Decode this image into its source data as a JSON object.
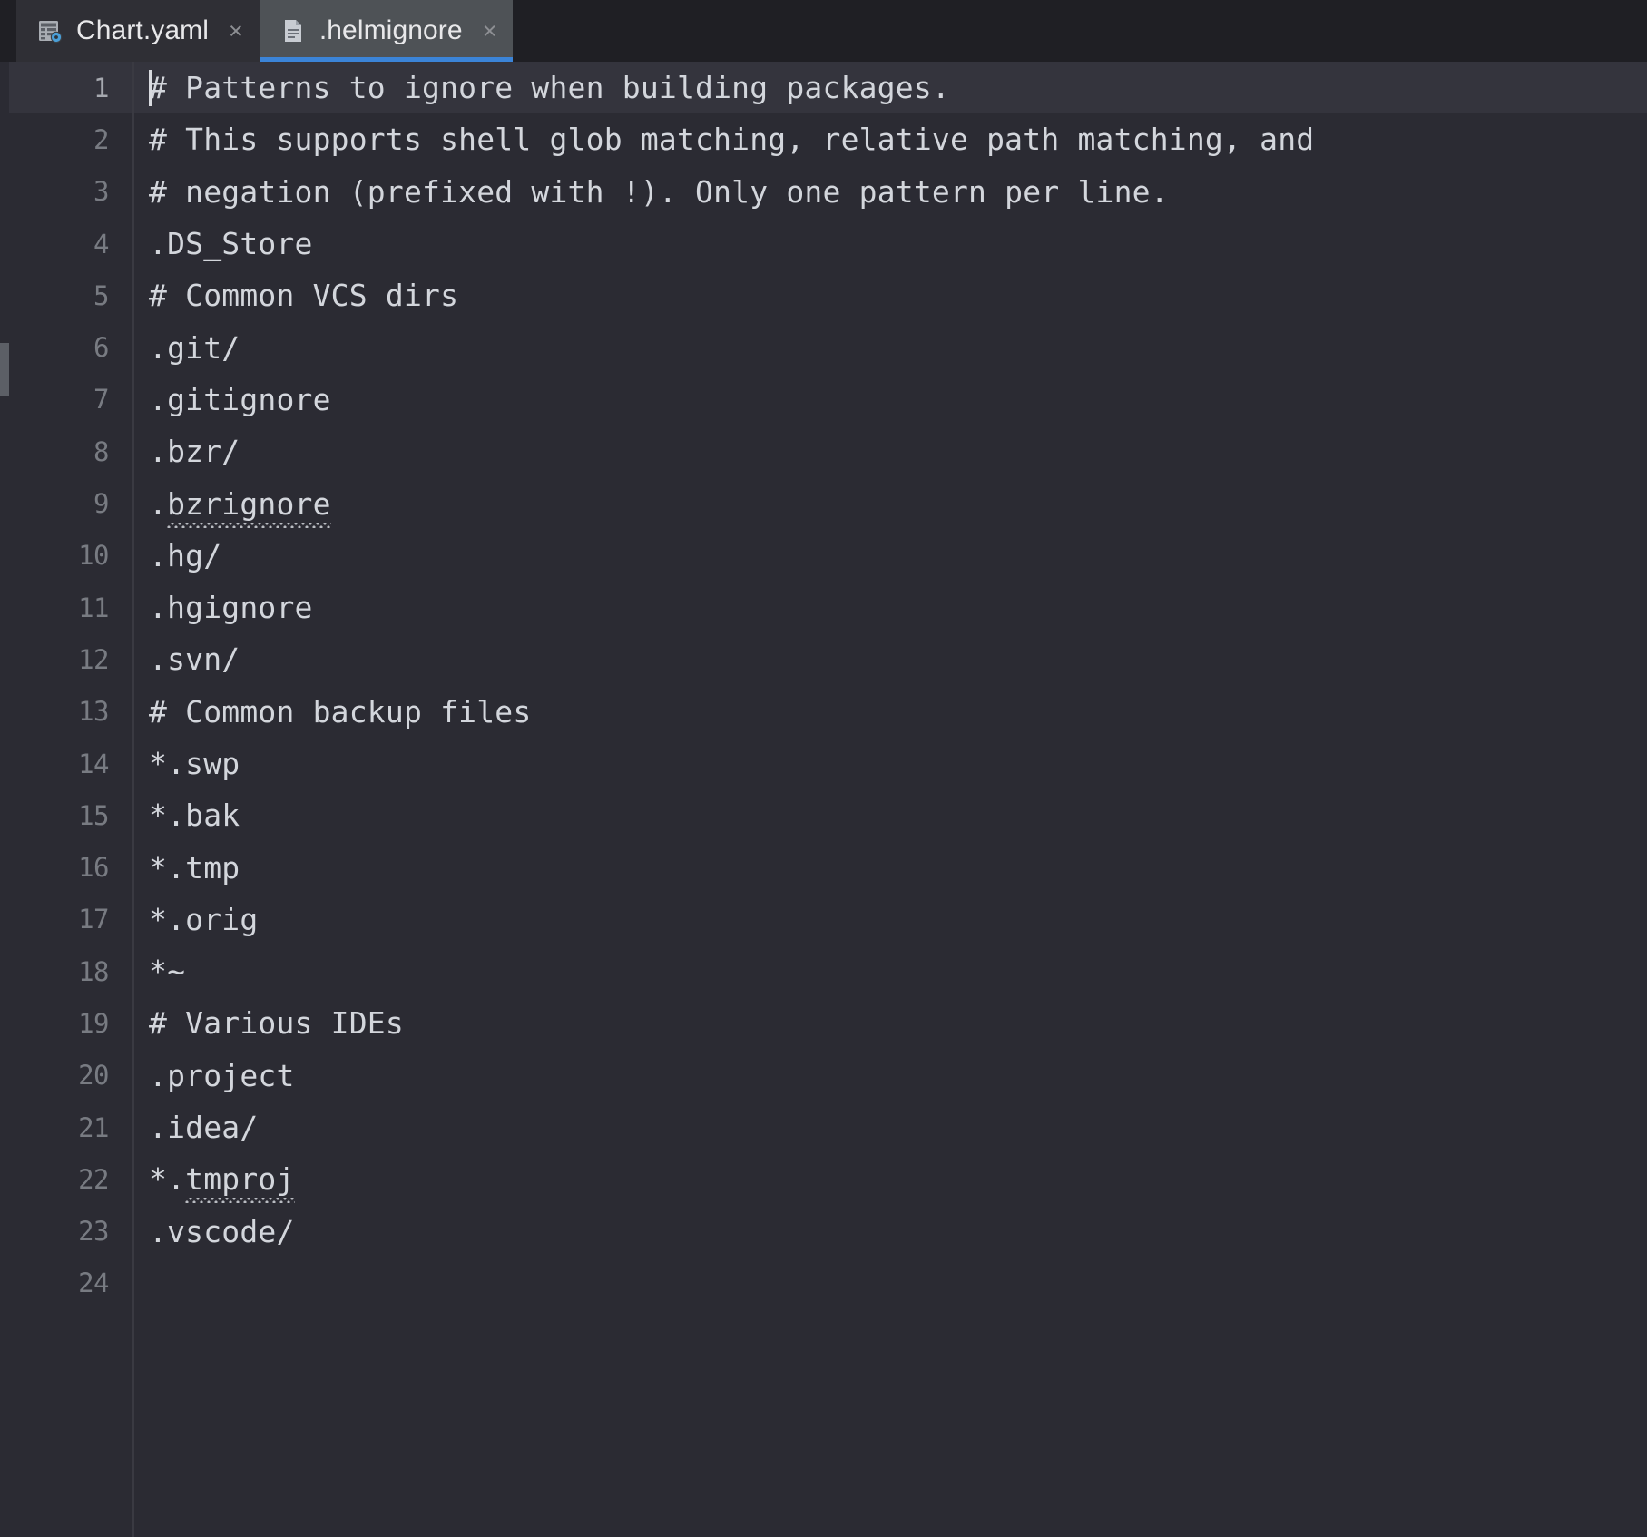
{
  "window": {
    "theme": "darcula",
    "colors": {
      "editor_bg": "#2b2b33",
      "tabbar_bg": "#1f1f24",
      "tab_active_bg": "#4e5256",
      "tab_inactive_bg": "#2f2f35",
      "active_tab_underline": "#3b84d8",
      "gutter_text": "#787b82",
      "code_text": "#d3d6dc",
      "current_line_bg": "#34343d",
      "squiggle": "#b9bcc2"
    }
  },
  "tabs": [
    {
      "label": "Chart.yaml",
      "icon": "yaml-config-file-icon",
      "close_glyph": "×",
      "active": false
    },
    {
      "label": ".helmignore",
      "icon": "text-file-icon",
      "close_glyph": "×",
      "active": true
    }
  ],
  "editor": {
    "active_file": ".helmignore",
    "caret": {
      "line": 1,
      "column": 1
    },
    "current_line": 1,
    "total_lines": 24,
    "line_numbers": [
      "1",
      "2",
      "3",
      "4",
      "5",
      "6",
      "7",
      "8",
      "9",
      "10",
      "11",
      "12",
      "13",
      "14",
      "15",
      "16",
      "17",
      "18",
      "19",
      "20",
      "21",
      "22",
      "23",
      "24"
    ],
    "lines": [
      {
        "n": 1,
        "text": "# Patterns to ignore when building packages."
      },
      {
        "n": 2,
        "text": "# This supports shell glob matching, relative path matching, and"
      },
      {
        "n": 3,
        "text": "# negation (prefixed with !). Only one pattern per line."
      },
      {
        "n": 4,
        "text": ".DS_Store"
      },
      {
        "n": 5,
        "text": "# Common VCS dirs"
      },
      {
        "n": 6,
        "text": ".git/"
      },
      {
        "n": 7,
        "text": ".gitignore"
      },
      {
        "n": 8,
        "text": ".bzr/"
      },
      {
        "n": 9,
        "text": ".bzrignore",
        "prefix": ".",
        "spelling_error": "bzrignore"
      },
      {
        "n": 10,
        "text": ".hg/"
      },
      {
        "n": 11,
        "text": ".hgignore"
      },
      {
        "n": 12,
        "text": ".svn/"
      },
      {
        "n": 13,
        "text": "# Common backup files"
      },
      {
        "n": 14,
        "text": "*.swp"
      },
      {
        "n": 15,
        "text": "*.bak"
      },
      {
        "n": 16,
        "text": "*.tmp"
      },
      {
        "n": 17,
        "text": "*.orig"
      },
      {
        "n": 18,
        "text": "*~"
      },
      {
        "n": 19,
        "text": "# Various IDEs"
      },
      {
        "n": 20,
        "text": ".project"
      },
      {
        "n": 21,
        "text": ".idea/"
      },
      {
        "n": 22,
        "text": "*.tmproj",
        "prefix": "*.",
        "spelling_error": "tmproj"
      },
      {
        "n": 23,
        "text": ".vscode/"
      },
      {
        "n": 24,
        "text": ""
      }
    ]
  },
  "scrollbar": {
    "orientation": "vertical",
    "position": "left",
    "visible": true
  }
}
